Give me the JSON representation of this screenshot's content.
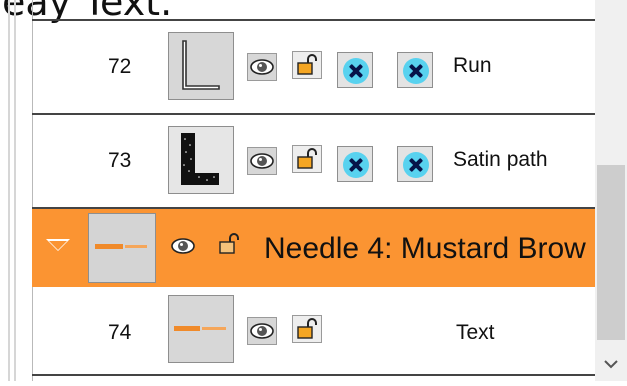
{
  "top_caption": "eay Text.",
  "rows": [
    {
      "number": "72",
      "label": "Run",
      "thumb_icon": "l-shape-run-thumbnail"
    },
    {
      "number": "73",
      "label": "Satin path",
      "thumb_icon": "l-shape-satin-thumbnail"
    },
    {
      "number": "74",
      "label": "Text",
      "thumb_icon": "orange-text-thumbnail"
    }
  ],
  "group": {
    "label": "Needle 4: Mustard Brow",
    "color": "#fb9432",
    "expanded": true
  },
  "icons": {
    "visibility": "eye-icon",
    "lock": "unlock-icon",
    "remove": "x-circle-icon"
  }
}
